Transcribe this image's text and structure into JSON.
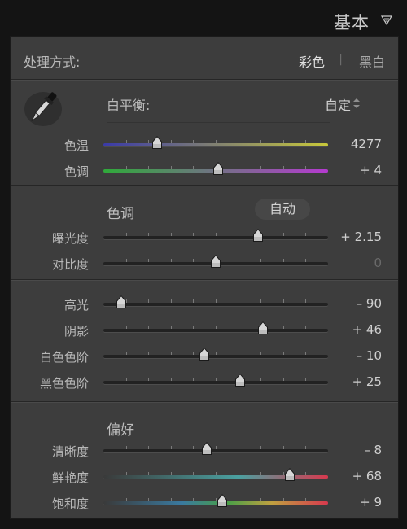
{
  "header": {
    "title": "基本",
    "collapse_icon": "triangle-down-icon"
  },
  "process": {
    "label": "处理方式:",
    "color": "彩色",
    "separator": "|",
    "bw": "黑白"
  },
  "white_balance": {
    "eyedropper_icon": "eyedropper-icon",
    "label": "白平衡:",
    "value": "自定",
    "arrows_icon": "up-down-arrows-icon",
    "rows": [
      {
        "label": "色温",
        "value": "4277",
        "position": 0.24,
        "track": "temp"
      },
      {
        "label": "色调",
        "value": "+ 4",
        "position": 0.51,
        "track": "tint"
      }
    ]
  },
  "tone": {
    "title": "色调",
    "auto_label": "自动",
    "rows": [
      {
        "label": "曝光度",
        "value": "+ 2.15",
        "position": 0.69
      },
      {
        "label": "对比度",
        "value": "0",
        "position": 0.5
      }
    ]
  },
  "tone_detail": {
    "rows": [
      {
        "label": "高光",
        "value": "– 90",
        "position": 0.08
      },
      {
        "label": "阴影",
        "value": "+ 46",
        "position": 0.71
      },
      {
        "label": "白色色阶",
        "value": "– 10",
        "position": 0.45
      },
      {
        "label": "黑色色阶",
        "value": "+ 25",
        "position": 0.61
      }
    ]
  },
  "presence": {
    "title": "偏好",
    "rows": [
      {
        "label": "清晰度",
        "value": "– 8",
        "position": 0.46,
        "track": "gray"
      },
      {
        "label": "鲜艳度",
        "value": "+ 68",
        "position": 0.83,
        "track": "vibrance"
      },
      {
        "label": "饱和度",
        "value": "+ 9",
        "position": 0.53,
        "track": "saturation"
      }
    ]
  },
  "colors": {
    "temp_left": "#3a3aa8",
    "temp_right": "#c8c83a",
    "tint_left": "#2faa3a",
    "tint_right": "#b53ad0",
    "vib_mid": "#4aa0a0",
    "vib_right": "#d8394e"
  }
}
